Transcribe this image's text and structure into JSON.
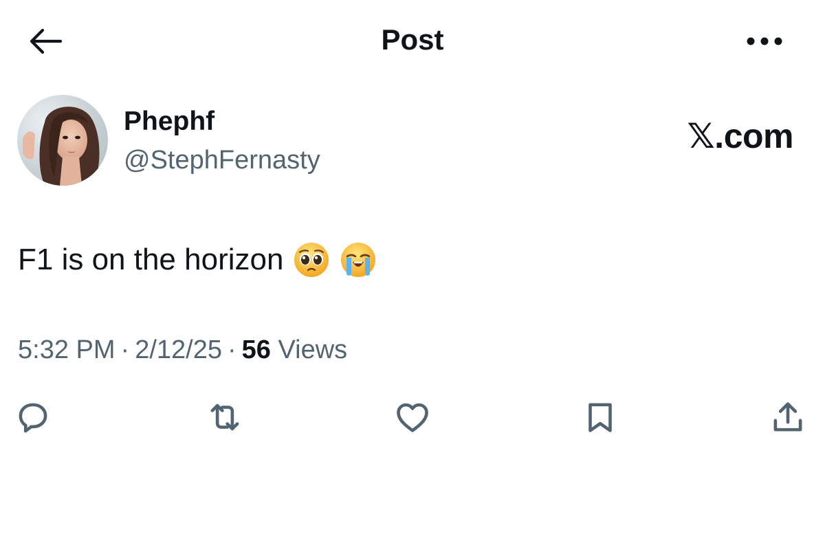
{
  "header": {
    "title": "Post",
    "back_icon": "arrow-left-icon",
    "more_icon": "more-horizontal-icon"
  },
  "author": {
    "display_name": "Phephf",
    "handle": "@StephFernasty",
    "avatar_icon": "avatar-photo"
  },
  "watermark": "𝕏.com",
  "post": {
    "text": "F1 is on the horizon",
    "emojis": [
      "pleading-face-emoji",
      "loudly-crying-face-emoji"
    ]
  },
  "meta": {
    "time": "5:32 PM",
    "date": "2/12/25",
    "separator": "·",
    "views_count": "56",
    "views_label": "Views"
  },
  "actions": [
    {
      "name": "reply",
      "icon": "reply-icon"
    },
    {
      "name": "repost",
      "icon": "repost-icon"
    },
    {
      "name": "like",
      "icon": "heart-icon"
    },
    {
      "name": "bookmark",
      "icon": "bookmark-icon"
    },
    {
      "name": "share",
      "icon": "share-icon"
    }
  ],
  "colors": {
    "text_primary": "#0f1419",
    "text_secondary": "#536471",
    "background": "#ffffff"
  }
}
